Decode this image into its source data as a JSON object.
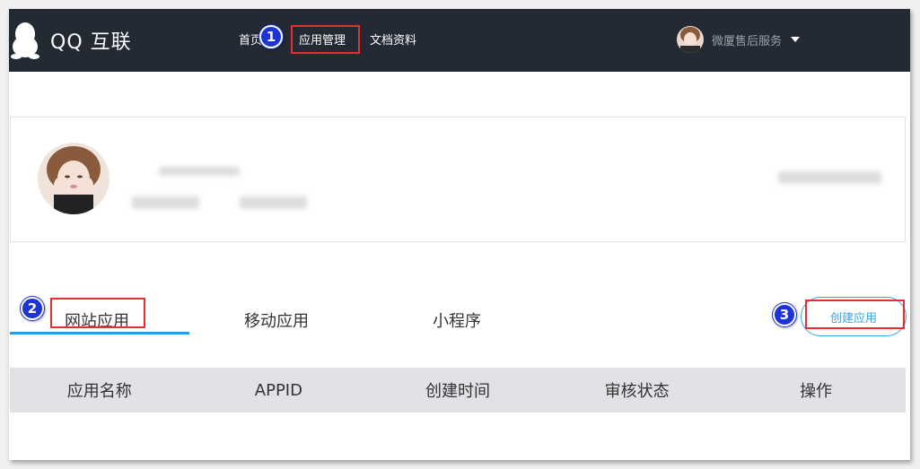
{
  "brand": {
    "logo_text": "QQ 互联"
  },
  "nav": {
    "home_label": "首页",
    "apps_label": "应用管理",
    "docs_label": "文档资料"
  },
  "user": {
    "name": "微厦售后服务"
  },
  "steps": {
    "one": "1",
    "two": "2",
    "three": "3"
  },
  "tabs": [
    "网站应用",
    "移动应用",
    "小程序"
  ],
  "create_button": "创建应用",
  "table": {
    "columns": [
      "应用名称",
      "APPID",
      "创建时间",
      "审核状态",
      "操作"
    ]
  },
  "colors": {
    "navbar": "#232a33",
    "accent": "#2a9cd9",
    "highlight": "#e3302f",
    "badge": "#1e33d6",
    "table_header": "#e0e2e5"
  },
  "icons": [
    "qq-penguin-icon",
    "caret-down-icon"
  ]
}
